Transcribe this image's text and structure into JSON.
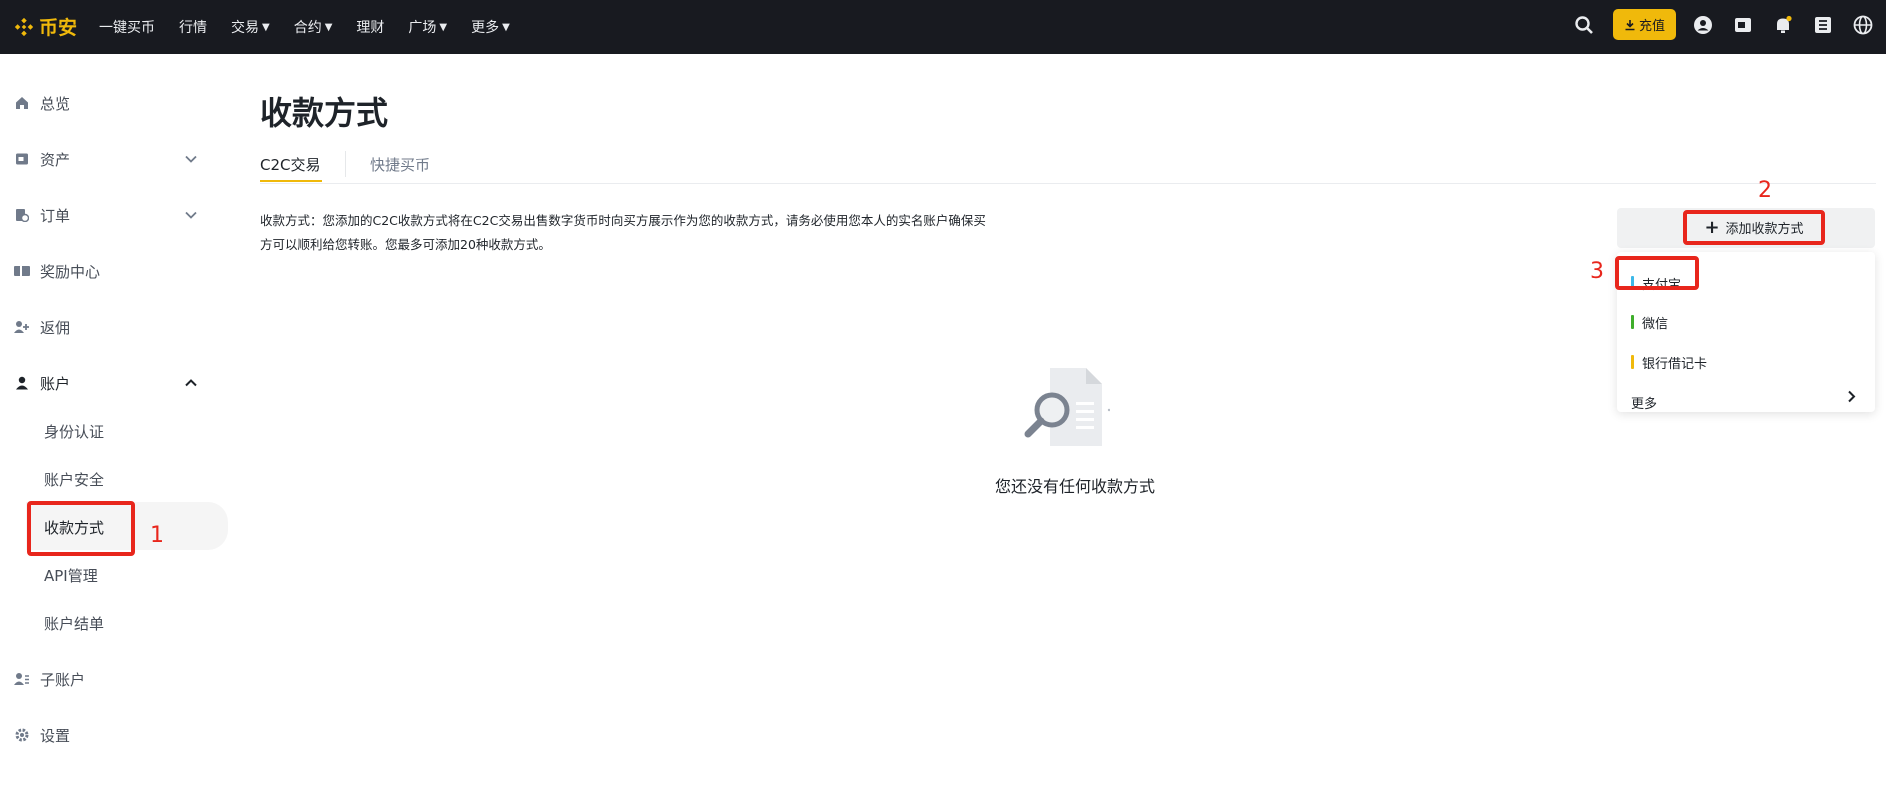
{
  "brand": {
    "name": "币安",
    "color": "#f0b90b"
  },
  "topnav": [
    {
      "label": "一键买币",
      "dropdown": false
    },
    {
      "label": "行情",
      "dropdown": false
    },
    {
      "label": "交易",
      "dropdown": true
    },
    {
      "label": "合约",
      "dropdown": true
    },
    {
      "label": "理财",
      "dropdown": false
    },
    {
      "label": "广场",
      "dropdown": true
    },
    {
      "label": "更多",
      "dropdown": true
    }
  ],
  "deposit_label": "充值",
  "header_icons": [
    "search-icon",
    "user-icon",
    "wallet-icon",
    "bell-icon",
    "orders-icon",
    "globe-icon"
  ],
  "sidebar": {
    "items": [
      {
        "label": "总览",
        "icon": "home-icon"
      },
      {
        "label": "资产",
        "icon": "wallet-icon",
        "expandable": true
      },
      {
        "label": "订单",
        "icon": "order-icon",
        "expandable": true
      },
      {
        "label": "奖励中心",
        "icon": "reward-icon"
      },
      {
        "label": "返佣",
        "icon": "referral-icon"
      },
      {
        "label": "账户",
        "icon": "person-icon",
        "expanded": true
      }
    ],
    "account_sub": [
      "身份认证",
      "账户安全",
      "收款方式",
      "API管理",
      "账户结单"
    ],
    "active_sub": "收款方式",
    "bottom_items": [
      {
        "label": "子账户",
        "icon": "subaccount-icon"
      },
      {
        "label": "设置",
        "icon": "settings-icon"
      }
    ]
  },
  "page": {
    "title": "收款方式",
    "tabs": [
      "C2C交易",
      "快捷买币"
    ],
    "active_tab": "C2C交易",
    "description": "收款方式：您添加的C2C收款方式将在C2C交易出售数字货币时向买方展示作为您的收款方式，请务必使用您本人的实名账户确保买方可以顺利给您转账。您最多可添加20种收款方式。",
    "add_button": "添加收款方式",
    "methods": [
      {
        "label": "支付宝",
        "color": "#3db8e8"
      },
      {
        "label": "微信",
        "color": "#3fae2b"
      },
      {
        "label": "银行借记卡",
        "color": "#f0b90b"
      }
    ],
    "more_label": "更多",
    "empty_text": "您还没有任何收款方式"
  },
  "annotations": [
    "1",
    "2",
    "3"
  ]
}
